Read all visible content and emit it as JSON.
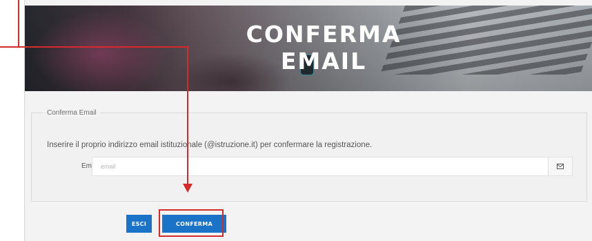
{
  "hero": {
    "title": "CONFERMA EMAIL"
  },
  "form": {
    "legend": "Conferma Email",
    "instructions": "Inserire il proprio indirizzo email istituzionale (@istruzione.it) per confermare la registrazione.",
    "email_label": "Email",
    "email_placeholder": "email",
    "email_value": "",
    "email_addon_icon": "envelope-icon"
  },
  "actions": {
    "esci_label": "ESCI",
    "conferma_label": "CONFERMA"
  },
  "colors": {
    "primary_button": "#1b73c8",
    "annotation": "#d62a2a"
  }
}
